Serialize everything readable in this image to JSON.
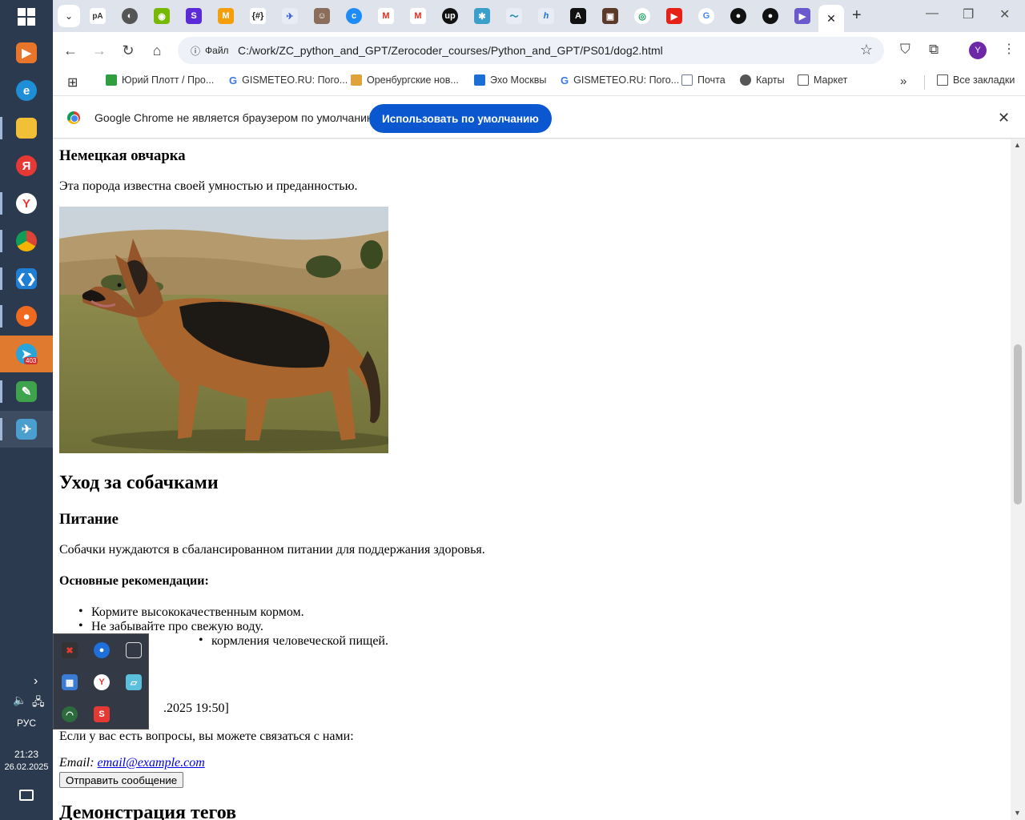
{
  "taskbar": {
    "language": "РУС",
    "time": "21:23",
    "date": "26.02.2025",
    "telegram_badge": "403"
  },
  "tabs": {
    "active_close": "✕",
    "new_tab": "+"
  },
  "toolbar": {
    "site_info_label": "Файл",
    "url": "C:/work/ZC_python_and_GPT/Zerocoder_courses/Python_and_GPT/PS01/dog2.html",
    "profile_initial": "Y"
  },
  "bookmarks": {
    "items": [
      {
        "label": "Юрий Плотт / Про...",
        "color": "#2e9e3e"
      },
      {
        "label": "GISMETEO.RU: Пого...",
        "color": "#3b78e7"
      },
      {
        "label": "Оренбургские нов...",
        "color": "#e0a23a"
      },
      {
        "label": "Эхо Москвы",
        "color": "#1a6fd6"
      },
      {
        "label": "GISMETEO.RU: Пого...",
        "color": "#3b78e7"
      },
      {
        "label": "Почта",
        "color": "#6b7a99"
      },
      {
        "label": "Карты",
        "color": "#555555"
      },
      {
        "label": "Маркет",
        "color": "#555555"
      }
    ],
    "all_bookmarks": "Все закладки"
  },
  "infobar": {
    "message": "Google Chrome не является браузером по умолчанию.",
    "button": "Использовать по умолчанию"
  },
  "page": {
    "h_shepherd": "Немецкая овчарка",
    "p_shepherd": "Эта порода известна своей умностью и преданностью.",
    "h_care": "Уход за собачками",
    "h_food": "Питание",
    "p_food": "Собачки нуждаются в сбалансированном питании для поддержания здоровья.",
    "h_recs": "Основные рекомендации:",
    "recs": [
      "Кормите высококачественным кормом.",
      "Не забывайте про свежую воду.",
      "кормления человеческой пищей."
    ],
    "date_fragment": ".2025 19:50]",
    "p_contact": "Если у вас есть вопросы, вы можете связаться с нами:",
    "email_label": "Email:",
    "email": "email@example.com",
    "send_button": "Отправить сообщение",
    "h_tags": "Демонстрация тегов"
  }
}
